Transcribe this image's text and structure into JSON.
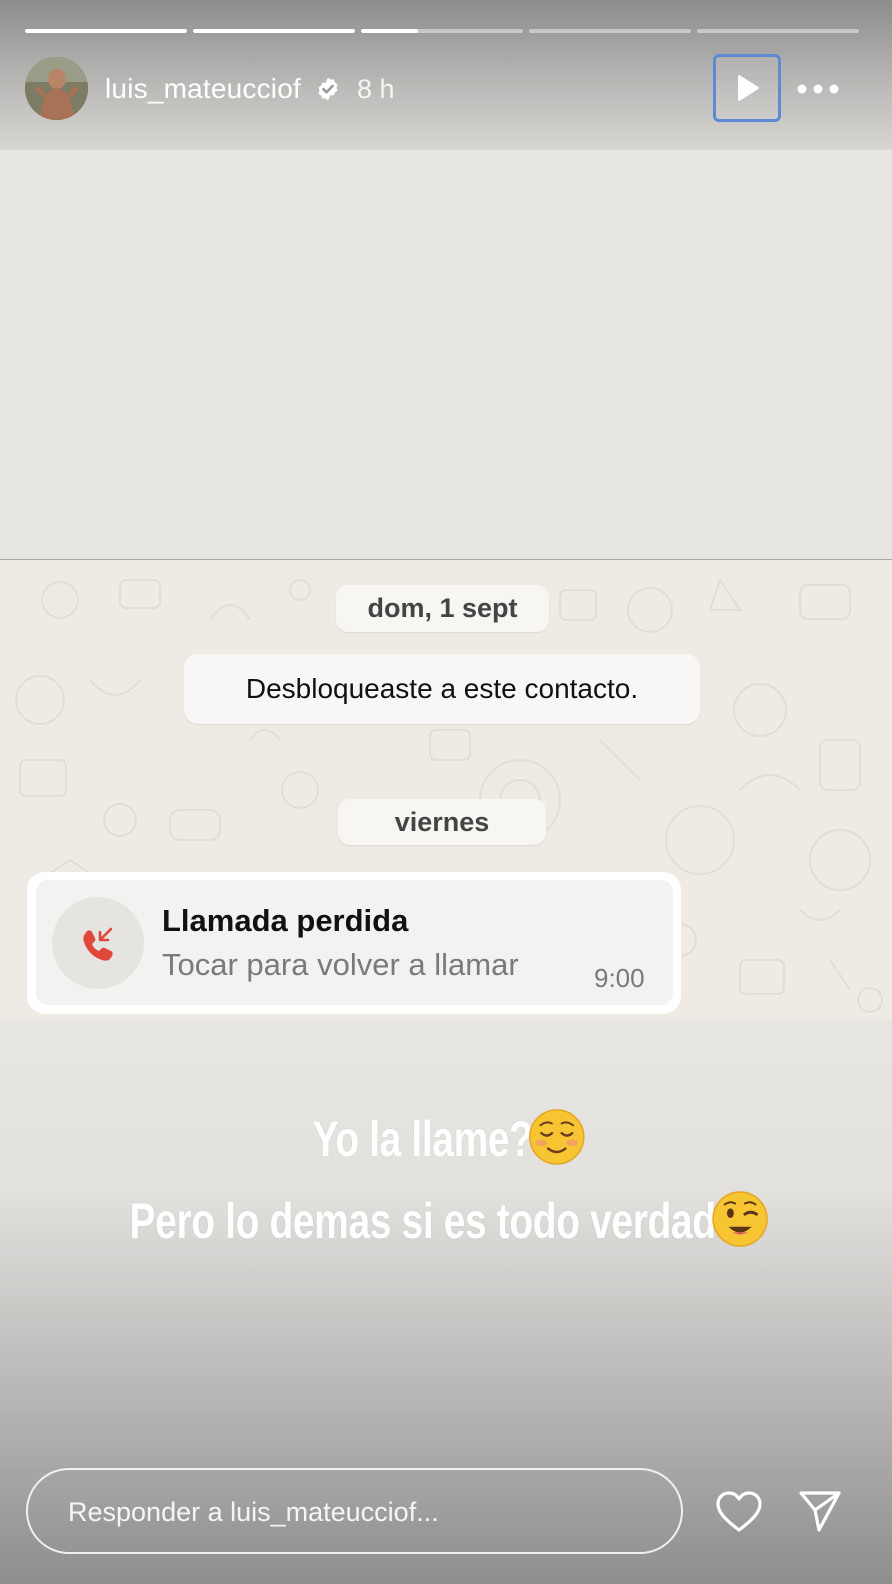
{
  "story": {
    "progress": [
      1,
      1,
      0.35,
      0,
      0
    ],
    "username": "luis_mateucciof",
    "verified": true,
    "time_ago": "8 h",
    "icons": {
      "verified": "verified-badge-icon",
      "play": "play-icon",
      "more": "more-horizontal-icon",
      "heart": "heart-icon",
      "send": "send-icon",
      "missed_call": "missed-call-icon"
    }
  },
  "chat": {
    "date_chip_1": "dom, 1 sept",
    "system_message": "Desbloqueaste a este contacto.",
    "date_chip_2": "viernes",
    "call": {
      "title": "Llamada perdida",
      "subtitle": "Tocar para volver a llamar",
      "time": "9:00"
    }
  },
  "overlay": {
    "line1": "Yo la llame?",
    "line1_emoji": "☺️",
    "line2": "Pero lo demas si es todo verdad",
    "line2_emoji": "😉"
  },
  "reply": {
    "placeholder": "Responder a luis_mateucciof..."
  },
  "colors": {
    "missed_call": "#e0463a",
    "play_focus": "#5b8bd6",
    "chat_bg": "#efeae3"
  }
}
